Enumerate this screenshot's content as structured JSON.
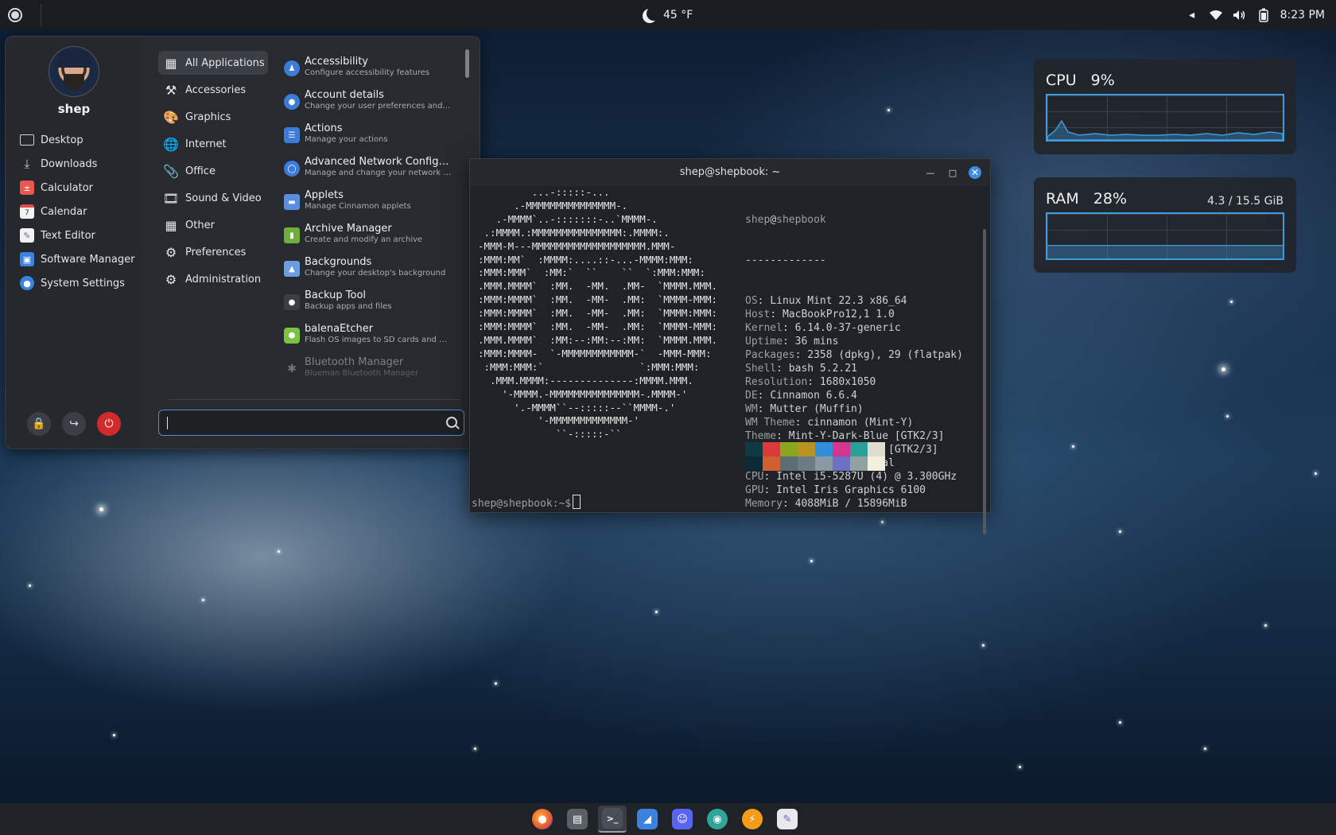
{
  "top_panel": {
    "weather_temp": "45 °F",
    "clock": "8:23 PM"
  },
  "menu": {
    "username": "shep",
    "favorites": [
      {
        "label": "Desktop",
        "icon": "desktop-icon"
      },
      {
        "label": "Downloads",
        "icon": "download-icon"
      },
      {
        "label": "Calculator",
        "icon": "calculator-icon"
      },
      {
        "label": "Calendar",
        "icon": "calendar-icon"
      },
      {
        "label": "Text Editor",
        "icon": "text-editor-icon"
      },
      {
        "label": "Software Manager",
        "icon": "software-manager-icon"
      },
      {
        "label": "System Settings",
        "icon": "settings-icon"
      }
    ],
    "calendar_day": "7",
    "categories": [
      {
        "label": "All Applications",
        "icon": "grid-icon",
        "active": true
      },
      {
        "label": "Accessories",
        "icon": "tools-icon"
      },
      {
        "label": "Graphics",
        "icon": "palette-icon"
      },
      {
        "label": "Internet",
        "icon": "globe-icon"
      },
      {
        "label": "Office",
        "icon": "paperclip-icon"
      },
      {
        "label": "Sound & Video",
        "icon": "film-icon"
      },
      {
        "label": "Other",
        "icon": "grid-icon"
      },
      {
        "label": "Preferences",
        "icon": "sliders-icon"
      },
      {
        "label": "Administration",
        "icon": "gear-icon"
      }
    ],
    "apps": [
      {
        "name": "Accessibility",
        "desc": "Configure accessibility features",
        "icon": "accessibility-icon",
        "color": "#3d7bd9"
      },
      {
        "name": "Account details",
        "desc": "Change your user preferences and pa...",
        "icon": "account-icon",
        "color": "#3d7bd9"
      },
      {
        "name": "Actions",
        "desc": "Manage your actions",
        "icon": "actions-icon",
        "color": "#3d7bd9"
      },
      {
        "name": "Advanced Network Configura...",
        "desc": "Manage and change your network con...",
        "icon": "network-icon",
        "color": "#3d7bd9"
      },
      {
        "name": "Applets",
        "desc": "Manage Cinnamon applets",
        "icon": "applets-icon",
        "color": "#5a8de0"
      },
      {
        "name": "Archive Manager",
        "desc": "Create and modify an archive",
        "icon": "archive-icon",
        "color": "#6fae3b"
      },
      {
        "name": "Backgrounds",
        "desc": "Change your desktop's background",
        "icon": "backgrounds-icon",
        "color": "#6a9ee0"
      },
      {
        "name": "Backup Tool",
        "desc": "Backup apps and files",
        "icon": "backup-icon",
        "color": "#3b3f45"
      },
      {
        "name": "balenaEtcher",
        "desc": "Flash OS images to SD cards and USB ...",
        "icon": "etcher-icon",
        "color": "#7cc242"
      },
      {
        "name": "Bluetooth Manager",
        "desc": "Blueman Bluetooth Manager",
        "icon": "bluetooth-icon",
        "color": "#4b5058"
      }
    ]
  },
  "terminal": {
    "title": "shep@shepbook: ~",
    "logo": "         ...-:::::-...\n      .-MMMMMMMMMMMMMMM-.\n   .-MMMM`..-:::::::-..`MMMM-.\n .:MMMM.:MMMMMMMMMMMMMMM:.MMMM:.\n-MMM-M---MMMMMMMMMMMMMMMMMMM.MMM-\n:MMM:MM`  :MMMM:....::-...-MMMM:MMM:\n:MMM:MMM`  :MM:`  ``    ``  `:MMM:MMM:\n.MMM.MMMM`  :MM.  -MM.  .MM-  `MMMM.MMM.\n:MMM:MMMM`  :MM.  -MM-  .MM:  `MMMM-MMM:\n:MMM:MMMM`  :MM.  -MM-  .MM:  `MMMM:MMM:\n:MMM:MMMM`  :MM.  -MM-  .MM:  `MMMM-MMM:\n.MMM.MMMM`  :MM:--:MM:--:MM:  `MMMM.MMM.\n:MMM:MMMM-  `-MMMMMMMMMMMM-`  -MMM-MMM:\n :MMM:MMM:`                `:MMM:MMM:\n  .MMM.MMMM:--------------:MMMM.MMM.\n    '-MMMM.-MMMMMMMMMMMMMMM-.MMMM-'\n      '.-MMMM``--:::::--``MMMM-.'\n          '-MMMMMMMMMMMMM-'\n             ``-:::::-``",
    "host_user": "shep",
    "host_name": "shepbook",
    "separator": "-------------",
    "info": [
      {
        "key": "OS",
        "value": "Linux Mint 22.3 x86_64"
      },
      {
        "key": "Host",
        "value": "MacBookPro12,1 1.0"
      },
      {
        "key": "Kernel",
        "value": "6.14.0-37-generic"
      },
      {
        "key": "Uptime",
        "value": "36 mins"
      },
      {
        "key": "Packages",
        "value": "2358 (dpkg), 29 (flatpak)"
      },
      {
        "key": "Shell",
        "value": "bash 5.2.21"
      },
      {
        "key": "Resolution",
        "value": "1680x1050"
      },
      {
        "key": "DE",
        "value": "Cinnamon 6.6.4"
      },
      {
        "key": "WM",
        "value": "Mutter (Muffin)"
      },
      {
        "key": "WM Theme",
        "value": "cinnamon (Mint-Y)"
      },
      {
        "key": "Theme",
        "value": "Mint-Y-Dark-Blue [GTK2/3]"
      },
      {
        "key": "Icons",
        "value": "Tela-black-dark [GTK2/3]"
      },
      {
        "key": "Terminal",
        "value": "gnome-terminal"
      },
      {
        "key": "CPU",
        "value": "Intel i5-5287U (4) @ 3.300GHz"
      },
      {
        "key": "GPU",
        "value": "Intel Iris Graphics 6100"
      },
      {
        "key": "Memory",
        "value": "4088MiB / 15896MiB"
      }
    ],
    "palette_top": [
      "#0f3a44",
      "#d93a3a",
      "#8aa51f",
      "#b89320",
      "#2f8fd8",
      "#d4358f",
      "#2aa198",
      "#e0ddd0"
    ],
    "palette_bottom": [
      "#0b2b34",
      "#d0612f",
      "#5b6d75",
      "#6b7c84",
      "#8a9aa3",
      "#6c71c4",
      "#93a1a1",
      "#f3efdd"
    ],
    "prompt": "shep@shepbook:~$"
  },
  "desklets": {
    "cpu": {
      "label": "CPU",
      "percent": "9%",
      "usage_fraction": 0.09
    },
    "ram": {
      "label": "RAM",
      "percent": "28%",
      "usage": "4.3 / 15.5 GiB",
      "usage_fraction": 0.28
    }
  },
  "taskbar": [
    {
      "name": "firefox-icon",
      "color": "#e8602c"
    },
    {
      "name": "files-icon",
      "color": "#5b6068"
    },
    {
      "name": "terminal-icon",
      "color": "#4a4f57",
      "active": true
    },
    {
      "name": "bookmark-app-icon",
      "color": "#3b82e0"
    },
    {
      "name": "discord-icon",
      "color": "#5865f2"
    },
    {
      "name": "chat-app-icon",
      "color": "#2fa59a"
    },
    {
      "name": "bolt-app-icon",
      "color": "#f39c1a"
    },
    {
      "name": "text-editor-icon",
      "color": "#e8e8ee"
    }
  ]
}
